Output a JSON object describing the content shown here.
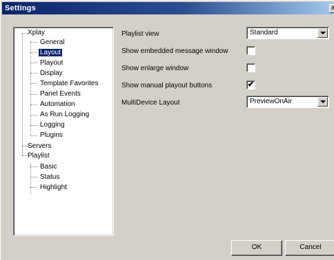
{
  "window": {
    "title": "Settings",
    "close_label": "x"
  },
  "tree": {
    "xplay": "Xplay",
    "xplay_children": [
      "General",
      "Layout",
      "Playout",
      "Display",
      "Template Favorites",
      "Panel Events",
      "Automation",
      "As Run Logging",
      "Logging",
      "Plugins"
    ],
    "servers": "Servers",
    "playlist": "Playlist",
    "playlist_children": [
      "Basic",
      "Status",
      "Highlight"
    ],
    "selected": "Layout"
  },
  "settings": {
    "playlist_view": {
      "label": "Playlist view",
      "value": "Standard"
    },
    "embedded_message": {
      "label": "Show embedded message window",
      "checked": false
    },
    "enlarge_window": {
      "label": "Show enlarge window",
      "checked": false
    },
    "manual_playout": {
      "label": "Show manual playout buttons",
      "checked": true,
      "mark": "✔"
    },
    "multidevice": {
      "label": "MultiDevice Layout",
      "value": "PreviewOnAir"
    }
  },
  "buttons": {
    "ok": "OK",
    "cancel": "Cancel"
  }
}
